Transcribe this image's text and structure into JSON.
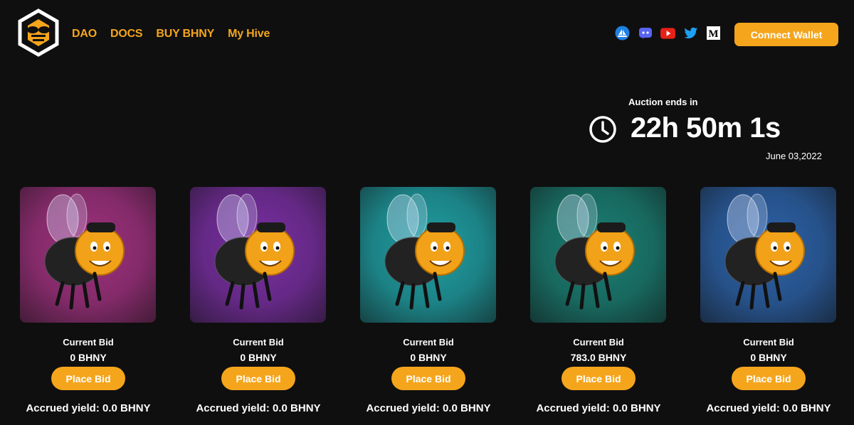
{
  "nav": {
    "links": [
      "DAO",
      "DOCS",
      "BUY BHNY",
      "My Hive"
    ],
    "connect_label": "Connect Wallet"
  },
  "socials": [
    {
      "icon": "opensea-icon",
      "color": "#2081e2"
    },
    {
      "icon": "discord-icon",
      "color": "#5865f2"
    },
    {
      "icon": "youtube-icon",
      "color": "#e62117"
    },
    {
      "icon": "twitter-icon",
      "color": "#1da1f2"
    },
    {
      "icon": "medium-icon",
      "color": "#ffffff"
    }
  ],
  "auction": {
    "label": "Auction ends in",
    "countdown": "22h 50m 1s",
    "date": "June 03,2022"
  },
  "cards": [
    {
      "label": "Current Bid",
      "bid": "0 BHNY",
      "button": "Place Bid",
      "yield": "Accrued yield: 0.0 BHNY",
      "bg": "#a0317f"
    },
    {
      "label": "Current Bid",
      "bid": "0 BHNY",
      "button": "Place Bid",
      "yield": "Accrued yield: 0.0 BHNY",
      "bg": "#7a2fa3"
    },
    {
      "label": "Current Bid",
      "bid": "0 BHNY",
      "button": "Place Bid",
      "yield": "Accrued yield: 0.0 BHNY",
      "bg": "#1f9fa3"
    },
    {
      "label": "Current Bid",
      "bid": "783.0 BHNY",
      "button": "Place Bid",
      "yield": "Accrued yield: 0.0 BHNY",
      "bg": "#1a7f73"
    },
    {
      "label": "Current Bid",
      "bid": "0 BHNY",
      "button": "Place Bid",
      "yield": "Accrued yield: 0.0 BHNY",
      "bg": "#2c62a8"
    }
  ],
  "colors": {
    "accent": "#f5a51c",
    "background": "#0f0f10"
  }
}
